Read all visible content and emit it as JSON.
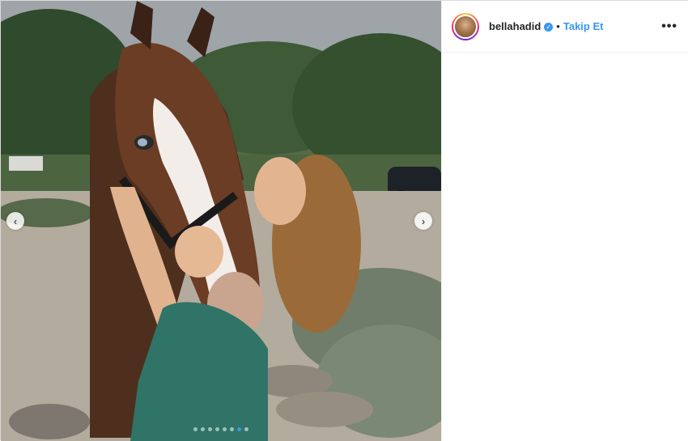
{
  "post": {
    "username": "bellahadid",
    "verified": true,
    "follow_label": "Takip Et",
    "separator": "•",
    "more_glyph": "•••",
    "nav_prev_glyph": "‹",
    "nav_next_glyph": "›",
    "carousel": {
      "total": 8,
      "active_index": 6
    }
  },
  "colors": {
    "accent": "#3897f0",
    "text": "#262626",
    "border": "#efefef"
  },
  "icons": {
    "verified": "verified-badge-icon",
    "more": "more-options-icon",
    "prev": "chevron-left-icon",
    "next": "chevron-right-icon"
  }
}
